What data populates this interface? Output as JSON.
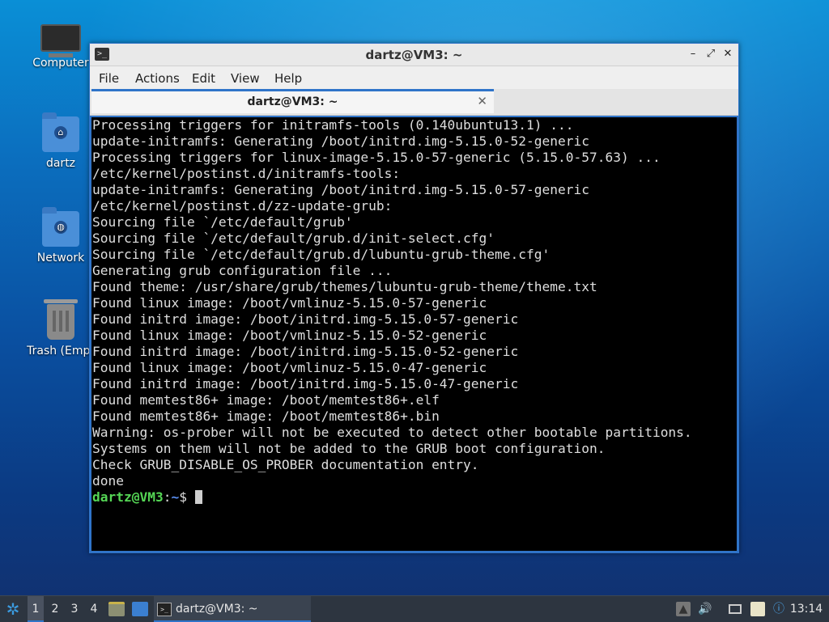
{
  "desktop": {
    "icons": [
      {
        "label": "Computer"
      },
      {
        "label": "dartz"
      },
      {
        "label": "Network"
      },
      {
        "label": "Trash (Empt"
      }
    ]
  },
  "window": {
    "title": "dartz@VM3: ~",
    "controls": {
      "minimize": "–",
      "maximize": "⤢",
      "close": "✕"
    },
    "menu": [
      "File",
      "Actions",
      "Edit",
      "View",
      "Help"
    ],
    "tab": {
      "label": "dartz@VM3: ~",
      "close": "✕"
    },
    "terminal": {
      "lines": [
        "Processing triggers for initramfs-tools (0.140ubuntu13.1) ...",
        "update-initramfs: Generating /boot/initrd.img-5.15.0-52-generic",
        "Processing triggers for linux-image-5.15.0-57-generic (5.15.0-57.63) ...",
        "/etc/kernel/postinst.d/initramfs-tools:",
        "update-initramfs: Generating /boot/initrd.img-5.15.0-57-generic",
        "/etc/kernel/postinst.d/zz-update-grub:",
        "Sourcing file `/etc/default/grub'",
        "Sourcing file `/etc/default/grub.d/init-select.cfg'",
        "Sourcing file `/etc/default/grub.d/lubuntu-grub-theme.cfg'",
        "Generating grub configuration file ...",
        "Found theme: /usr/share/grub/themes/lubuntu-grub-theme/theme.txt",
        "Found linux image: /boot/vmlinuz-5.15.0-57-generic",
        "Found initrd image: /boot/initrd.img-5.15.0-57-generic",
        "Found linux image: /boot/vmlinuz-5.15.0-52-generic",
        "Found initrd image: /boot/initrd.img-5.15.0-52-generic",
        "Found linux image: /boot/vmlinuz-5.15.0-47-generic",
        "Found initrd image: /boot/initrd.img-5.15.0-47-generic",
        "Found memtest86+ image: /boot/memtest86+.elf",
        "Found memtest86+ image: /boot/memtest86+.bin",
        "Warning: os-prober will not be executed to detect other bootable partitions.",
        "Systems on them will not be added to the GRUB boot configuration.",
        "Check GRUB_DISABLE_OS_PROBER documentation entry.",
        "done"
      ],
      "prompt": {
        "user": "dartz@VM3",
        "sep": ":",
        "path": "~",
        "dollar": "$ "
      }
    }
  },
  "taskbar": {
    "workspaces": [
      "1",
      "2",
      "3",
      "4"
    ],
    "active_workspace": "1",
    "task_label": "dartz@VM3: ~",
    "clock": "13:14",
    "colors": {
      "accent": "#2f74c9",
      "panel": "#2d3540"
    }
  }
}
